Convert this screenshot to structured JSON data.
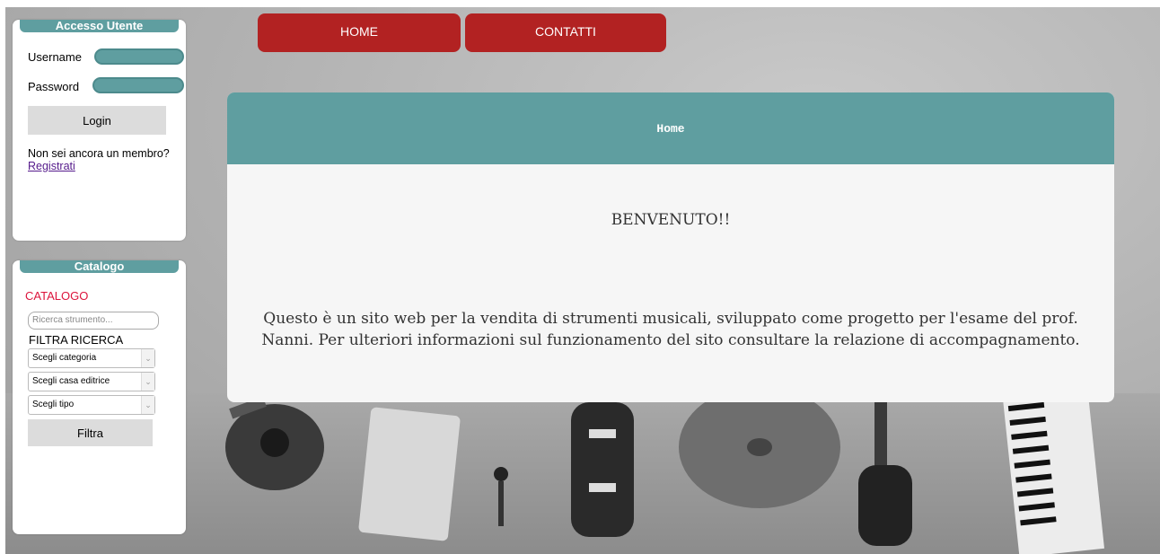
{
  "nav": {
    "home_label": "HOME",
    "contatti_label": "CONTATTI"
  },
  "login": {
    "title": "Accesso Utente",
    "username_label": "Username",
    "password_label": "Password",
    "login_label": "Login",
    "not_member_text": "Non sei ancora un membro?",
    "register_link": "Registrati"
  },
  "catalog": {
    "title": "Catalogo",
    "heading": "CATALOGO",
    "search_placeholder": "Ricerca strumento...",
    "filter_heading": "FILTRA RICERCA",
    "category_select": "Scegli categoria",
    "publisher_select": "Scegli casa editrice",
    "type_select": "Scegli tipo",
    "filter_button": "Filtra"
  },
  "main": {
    "header_title": "Home",
    "welcome": "BENVENUTO!!",
    "description": "Questo è un sito web per la vendita di strumenti musicali, sviluppato come progetto per l'esame del prof. Nanni. Per ulteriori informazioni sul funzionamento del sito consultare la relazione di accompagnamento."
  },
  "colors": {
    "accent_teal": "#5f9ea0",
    "nav_red": "#b22222",
    "catalog_heading": "#dc143c"
  }
}
